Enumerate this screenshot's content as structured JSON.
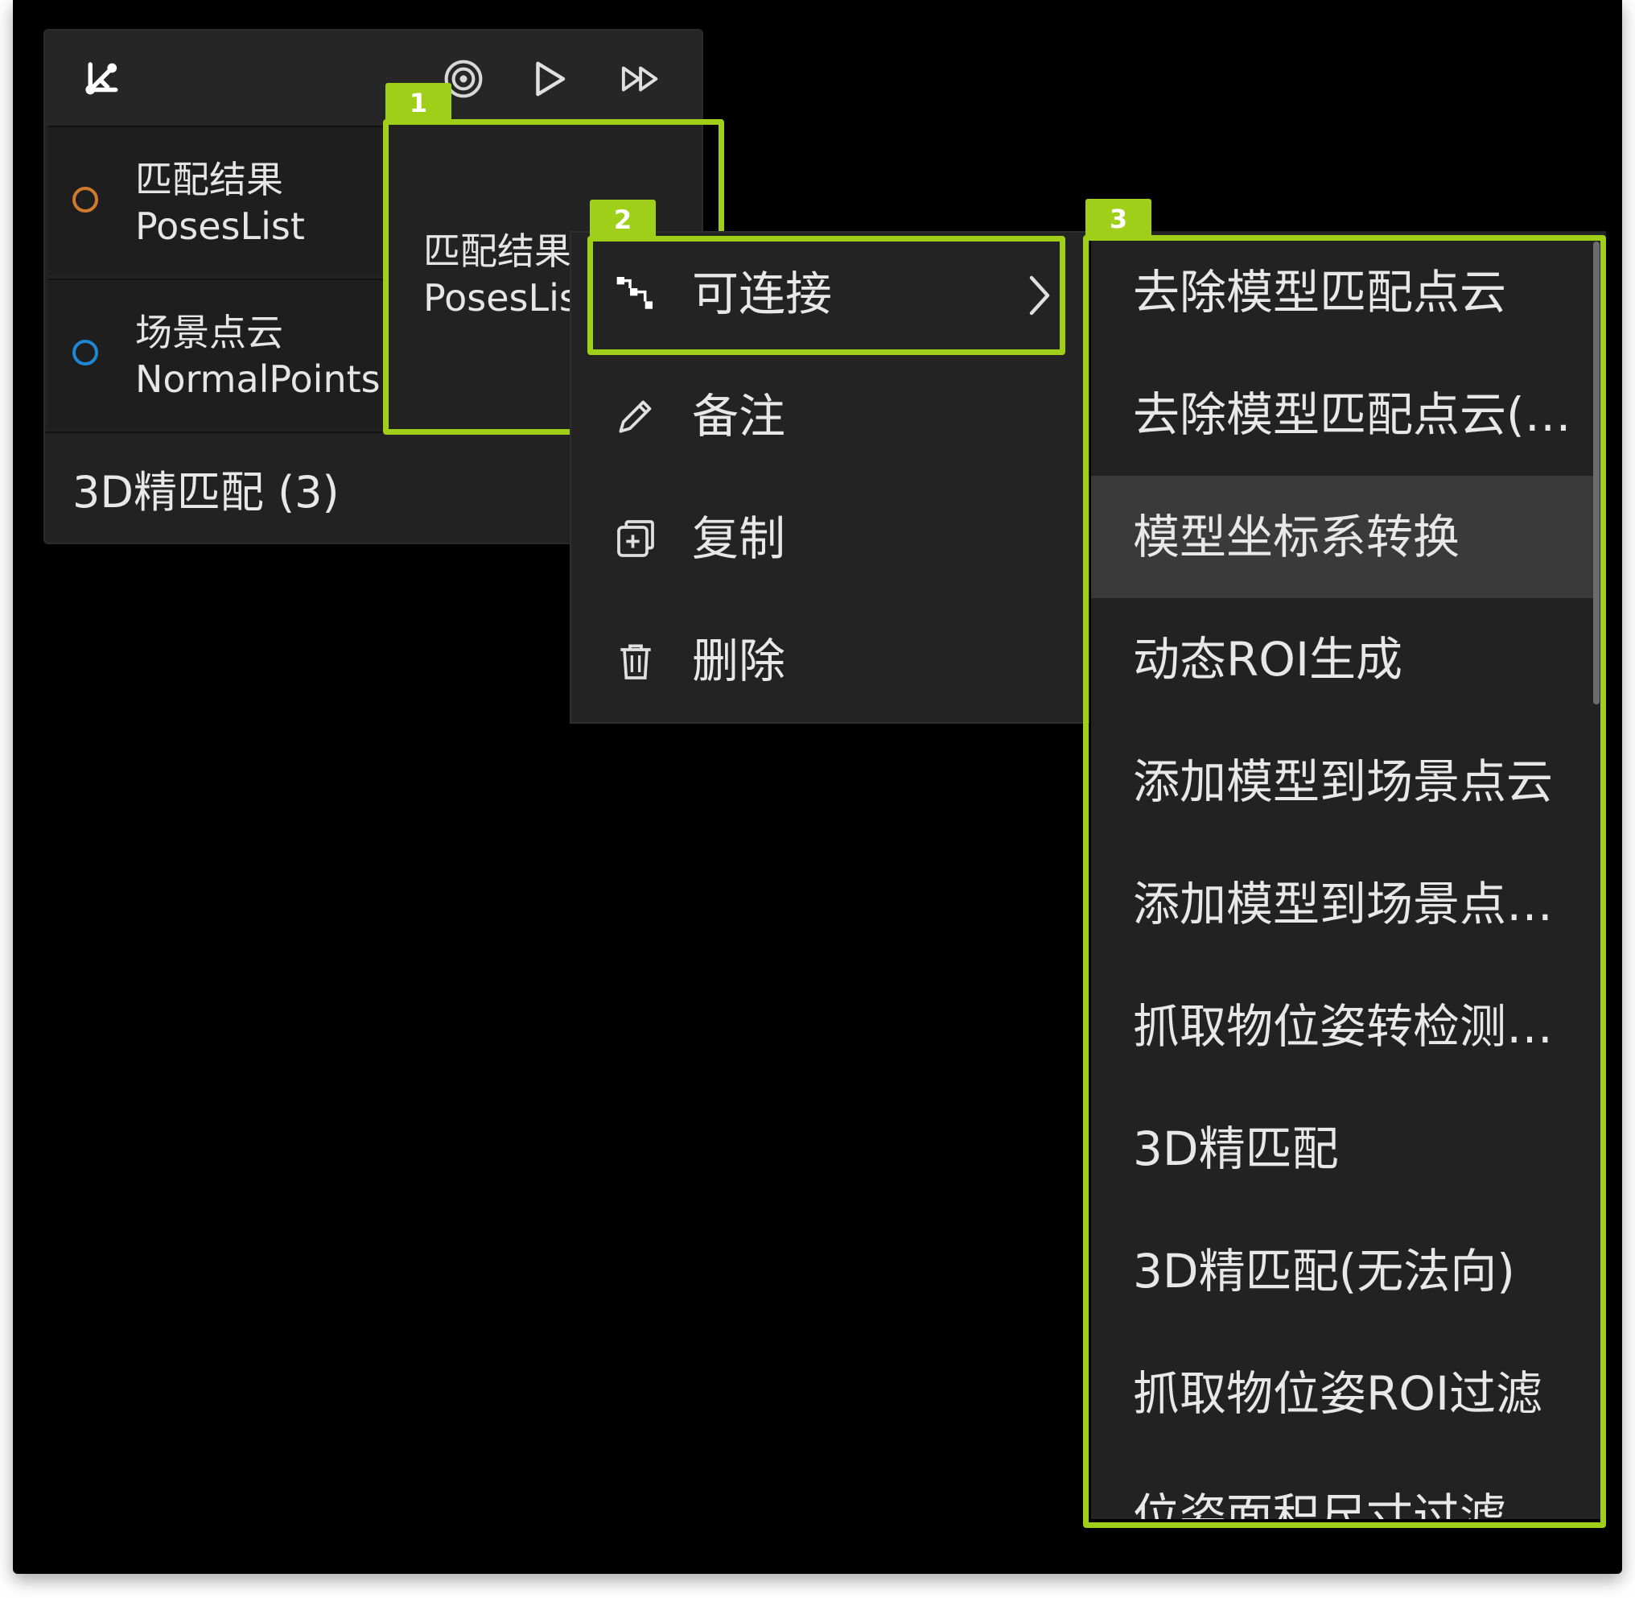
{
  "colors": {
    "accent": "#a0cf19",
    "port_orange": "#d07a2d",
    "port_blue": "#1f86d3"
  },
  "node": {
    "toolbar_icons": [
      "graph-icon",
      "target-icon",
      "play-icon",
      "fast-forward-icon"
    ],
    "inputs": [
      {
        "label_zh": "匹配结果",
        "label_en": "PosesList",
        "port_color": "orange"
      },
      {
        "label_zh": "场景点云",
        "label_en": "NormalPoints",
        "port_color": "blue"
      }
    ],
    "output": {
      "label_zh": "匹配结果",
      "label_en": "PosesLis"
    },
    "title": "3D精匹配 (3)"
  },
  "badges": [
    "1",
    "2",
    "3"
  ],
  "context_menu": {
    "items": [
      {
        "label": "可连接",
        "icon": "connect-icon",
        "has_submenu": true
      },
      {
        "label": "备注",
        "icon": "pencil-icon"
      },
      {
        "label": "复制",
        "icon": "copy-icon"
      },
      {
        "label": "删除",
        "icon": "trash-icon"
      }
    ]
  },
  "submenu": {
    "items": [
      "去除模型匹配点云",
      "去除模型匹配点云(…",
      "模型坐标系转换",
      "动态ROI生成",
      "添加模型到场景点云",
      "添加模型到场景点…",
      "抓取物位姿转检测…",
      "3D精匹配",
      "3D精匹配(无法向)",
      "抓取物位姿ROI过滤",
      "位姿面积尺寸过滤"
    ],
    "hovered_index": 2
  }
}
